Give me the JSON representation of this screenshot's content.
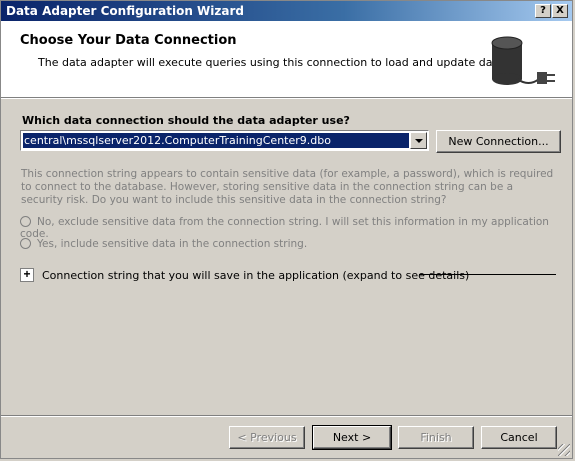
{
  "window": {
    "title": "Data Adapter Configuration Wizard",
    "help_button": "?",
    "close_button": "X"
  },
  "header": {
    "title": "Choose Your Data Connection",
    "subtitle": "The data adapter will execute queries using this connection to load and update data."
  },
  "connection": {
    "question": "Which data connection should the data adapter use?",
    "selected": "central\\mssqlserver2012.ComputerTrainingCenter9.dbo",
    "new_button": "New Connection..."
  },
  "sensitive": {
    "note": "This connection string appears to contain sensitive data (for example, a password), which is required to connect to the database. However, storing sensitive data in the connection string can be a security risk. Do you want to include this sensitive data in the connection string?",
    "option_no": "No, exclude sensitive data from the connection string. I will set this information in my application code.",
    "option_yes": "Yes, include sensitive data in the connection string."
  },
  "expander": {
    "symbol": "+",
    "label": "Connection string that you will save in the application (expand to see details)"
  },
  "footer": {
    "previous": "< Previous",
    "next": "Next >",
    "finish": "Finish",
    "cancel": "Cancel"
  }
}
